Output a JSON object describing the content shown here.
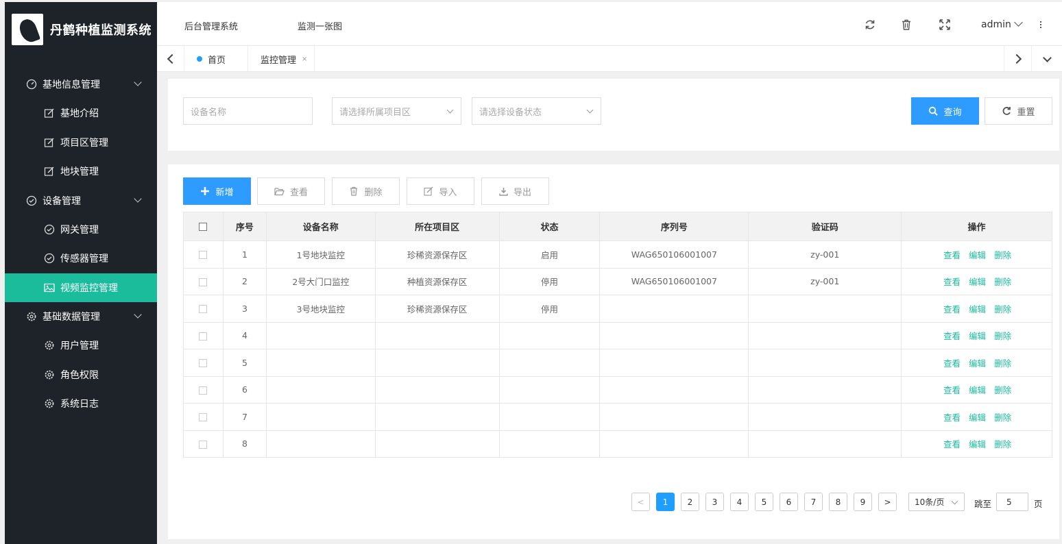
{
  "app": {
    "title": "丹鹤种植监测系统"
  },
  "header": {
    "links": [
      "后台管理系统",
      "监测一张图"
    ],
    "user": "admin"
  },
  "tabs": [
    {
      "label": "首页"
    },
    {
      "label": "监控管理",
      "close": "×"
    }
  ],
  "sidebar": {
    "groups": [
      {
        "label": "基地信息管理",
        "items": [
          "基地介绍",
          "项目区管理",
          "地块管理"
        ]
      },
      {
        "label": "设备管理",
        "items": [
          "网关管理",
          "传感器管理",
          "视频监控管理"
        ]
      },
      {
        "label": "基础数据管理",
        "items": [
          "用户管理",
          "角色权限",
          "系统日志"
        ]
      }
    ],
    "active_item": "视频监控管理"
  },
  "search": {
    "device_name_placeholder": "设备名称",
    "project_area_placeholder": "请选择所属项目区",
    "status_placeholder": "请选择设备状态",
    "query_label": "查询",
    "reset_label": "重置"
  },
  "toolbar": {
    "add_label": "新增",
    "view_label": "查看",
    "delete_label": "删除",
    "import_label": "导入",
    "export_label": "导出"
  },
  "table": {
    "columns": [
      "序号",
      "设备名称",
      "所在项目区",
      "状态",
      "序列号",
      "验证码",
      "操作"
    ],
    "rows": [
      [
        "1",
        "1号地块监控",
        "珍稀资源保存区",
        "启用",
        "WAG650106001007",
        "zy-001"
      ],
      [
        "2",
        "2号大门口监控",
        "种植资源保存区",
        "停用",
        "WAG650106001007",
        "zy-001"
      ],
      [
        "3",
        "3号地块监控",
        "珍稀资源保存区",
        "停用",
        "",
        ""
      ],
      [
        "4",
        "",
        "",
        "",
        "",
        ""
      ],
      [
        "5",
        "",
        "",
        "",
        "",
        ""
      ],
      [
        "6",
        "",
        "",
        "",
        "",
        ""
      ],
      [
        "7",
        "",
        "",
        "",
        "",
        ""
      ],
      [
        "8",
        "",
        "",
        "",
        "",
        ""
      ]
    ],
    "row_actions": [
      "查看",
      "编辑",
      "删除"
    ]
  },
  "pager": {
    "prev": "<",
    "pages": [
      "1",
      "2",
      "3",
      "4",
      "5",
      "6",
      "7",
      "8",
      "9"
    ],
    "current": "1",
    "next": ">",
    "page_size": "10条/页",
    "jump_label": "跳至",
    "jump_value": "5",
    "page_unit": "页"
  },
  "colors": {
    "sidebar_bg": "#1d2329",
    "accent": "#1abc9c",
    "primary": "#2d9bff",
    "page_active": "#1e9fff"
  }
}
